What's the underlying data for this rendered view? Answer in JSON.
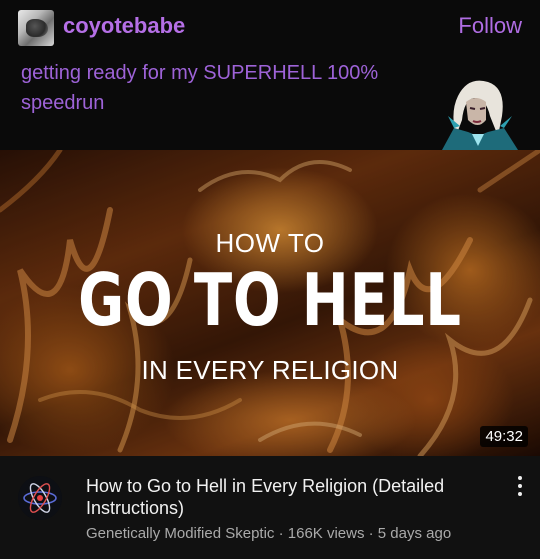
{
  "post": {
    "username": "coyotebabe",
    "follow_label": "Follow",
    "text": "getting ready for my SUPERHELL 100% speedrun"
  },
  "video": {
    "thumbnail_line1": "HOW TO",
    "thumbnail_line2": "GO TO HELL",
    "thumbnail_line3": "IN EVERY RELIGION",
    "duration": "49:32",
    "title": "How to Go to Hell in Every Religion (Detailed Instructions)",
    "subtitle": "Genetically Modified Skeptic · 166K views · 5 days ago"
  },
  "colors": {
    "accent": "#b06de3",
    "background": "#000000"
  },
  "icons": {
    "avatar": "user-avatar-icon",
    "character": "character-art-icon",
    "channel": "atom-channel-icon",
    "menu": "more-vertical-icon"
  }
}
